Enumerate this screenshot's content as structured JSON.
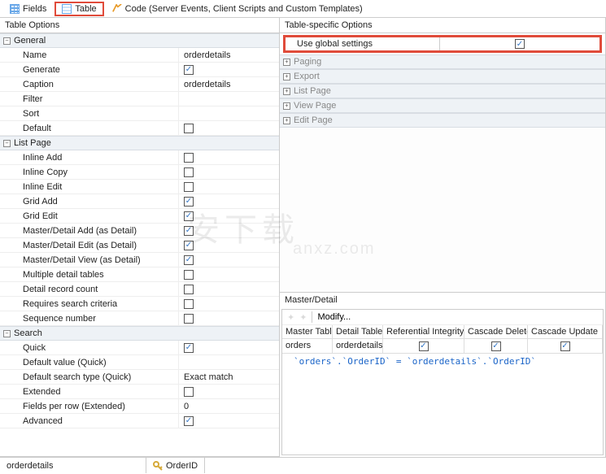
{
  "tabs": {
    "fields": "Fields",
    "table": "Table",
    "code": "Code (Server Events, Client Scripts and Custom Templates)"
  },
  "left_title": "Table Options",
  "right_title": "Table-specific Options",
  "groups": {
    "general": {
      "label": "General",
      "rows": [
        {
          "label": "Name",
          "value": "orderdetails",
          "type": "text"
        },
        {
          "label": "Generate",
          "value": true,
          "type": "check"
        },
        {
          "label": "Caption",
          "value": "orderdetails",
          "type": "text"
        },
        {
          "label": "Filter",
          "value": "",
          "type": "text"
        },
        {
          "label": "Sort",
          "value": "",
          "type": "text"
        },
        {
          "label": "Default",
          "value": false,
          "type": "check"
        }
      ]
    },
    "listpage": {
      "label": "List Page",
      "rows": [
        {
          "label": "Inline Add",
          "value": false,
          "type": "check"
        },
        {
          "label": "Inline Copy",
          "value": false,
          "type": "check"
        },
        {
          "label": "Inline Edit",
          "value": false,
          "type": "check"
        },
        {
          "label": "Grid Add",
          "value": true,
          "type": "check"
        },
        {
          "label": "Grid Edit",
          "value": true,
          "type": "check"
        },
        {
          "label": "Master/Detail Add (as Detail)",
          "value": true,
          "type": "check"
        },
        {
          "label": "Master/Detail Edit (as Detail)",
          "value": true,
          "type": "check"
        },
        {
          "label": "Master/Detail View (as Detail)",
          "value": true,
          "type": "check"
        },
        {
          "label": "Multiple detail tables",
          "value": false,
          "type": "check"
        },
        {
          "label": "Detail record count",
          "value": false,
          "type": "check"
        },
        {
          "label": "Requires search criteria",
          "value": false,
          "type": "check"
        },
        {
          "label": "Sequence number",
          "value": false,
          "type": "check"
        }
      ]
    },
    "search": {
      "label": "Search",
      "rows": [
        {
          "label": "Quick",
          "value": true,
          "type": "check"
        },
        {
          "label": "Default value (Quick)",
          "value": "",
          "type": "text"
        },
        {
          "label": "Default search type (Quick)",
          "value": "Exact match",
          "type": "text"
        },
        {
          "label": "Extended",
          "value": false,
          "type": "check"
        },
        {
          "label": "Fields per row (Extended)",
          "value": "0",
          "type": "text"
        },
        {
          "label": "Advanced",
          "value": true,
          "type": "check"
        }
      ]
    }
  },
  "right_groups": {
    "global": "Use global settings",
    "paging": "Paging",
    "export": "Export",
    "list": "List Page",
    "view": "View Page",
    "edit": "Edit Page"
  },
  "global_checked": true,
  "md": {
    "title": "Master/Detail",
    "modify": "Modify...",
    "headers": [
      "Master Table",
      "Detail Table",
      "Referential Integrity",
      "Cascade Delete",
      "Cascade Update"
    ],
    "row": {
      "master": "orders",
      "detail": "orderdetails",
      "ri": true,
      "cd": true,
      "cu": true
    },
    "expr": "`orders`.`OrderID` = `orderdetails`.`OrderID`"
  },
  "status": {
    "table": "orderdetails",
    "field": "OrderID"
  },
  "watermark": "安下载",
  "watermark2": "anxz.com"
}
